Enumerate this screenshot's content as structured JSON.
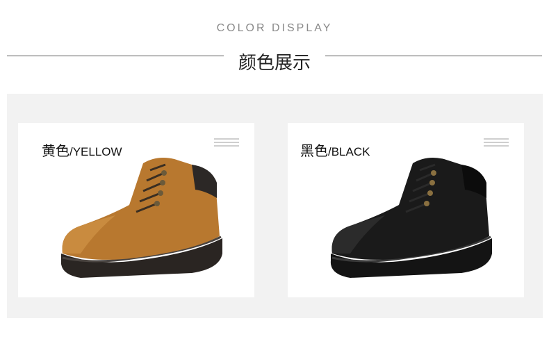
{
  "header": {
    "subtitle": "COLOR DISPLAY",
    "title": "颜色展示"
  },
  "colors": [
    {
      "cn": "黄色",
      "en": "/YELLOW",
      "boot_color": "#b8782f",
      "icon": "menu-lines-icon"
    },
    {
      "cn": "黑色",
      "en": "/BLACK",
      "boot_color": "#1a1a1a",
      "icon": "menu-lines-icon"
    }
  ],
  "theme": {
    "panel_bg": "#f2f2f2",
    "card_bg": "#ffffff",
    "line_color": "#555555"
  }
}
